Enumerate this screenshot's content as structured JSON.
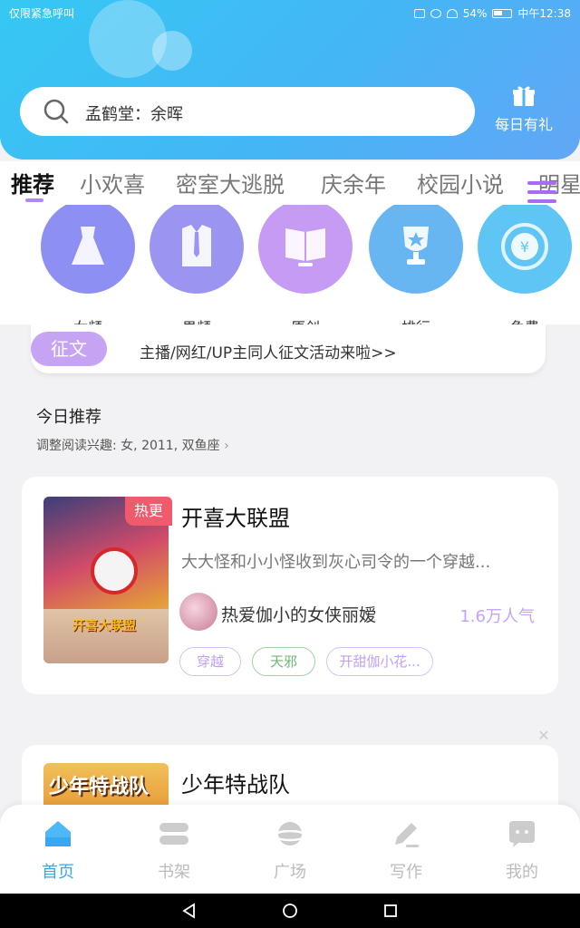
{
  "status_bar": {
    "left_text": "仅限紧急呼叫",
    "battery": "54%",
    "time": "中午12:38"
  },
  "search": {
    "placeholder": "孟鹤堂：余晖"
  },
  "gift": {
    "label": "每日有礼"
  },
  "tabs": [
    {
      "label": "推荐",
      "active": true
    },
    {
      "label": "小欢喜",
      "active": false
    },
    {
      "label": "密室大逃脱",
      "active": false
    },
    {
      "label": "庆余年",
      "active": false
    },
    {
      "label": "校园小说",
      "active": false
    },
    {
      "label": "明星",
      "active": false
    }
  ],
  "categories": [
    {
      "label": "女频",
      "icon": "dress-icon"
    },
    {
      "label": "男频",
      "icon": "shirt-icon"
    },
    {
      "label": "原创",
      "icon": "book-icon"
    },
    {
      "label": "排行",
      "icon": "trophy-icon"
    },
    {
      "label": "免费",
      "icon": "yuan-coin-icon"
    }
  ],
  "notice": {
    "badge": "征文",
    "text": "主播/网红/UP主同人征文活动来啦>>"
  },
  "recommend": {
    "title": "今日推荐",
    "subtitle": "调整阅读兴趣: 女, 2011, 双鱼座"
  },
  "books": [
    {
      "title": "开喜大联盟",
      "badge": "热更",
      "cover_text": "开喜大联盟",
      "description": "大大怪和小小怪收到灰心司令的一个穿越...",
      "author": "热爱伽小的女侠丽嫒",
      "popularity": "1.6万人气",
      "tags": [
        "穿越",
        "天邪",
        "开甜伽小花..."
      ]
    },
    {
      "title": "少年特战队",
      "cover_text": "少年特战队"
    }
  ],
  "bottom_nav": [
    {
      "label": "首页",
      "active": true
    },
    {
      "label": "书架",
      "active": false
    },
    {
      "label": "广场",
      "active": false
    },
    {
      "label": "写作",
      "active": false
    },
    {
      "label": "我的",
      "active": false
    }
  ],
  "colors": {
    "header_gradient_start": "#35c8f3",
    "accent_purple": "#c7a3f4",
    "accent_blue": "#36a8f0",
    "hot_badge": "#ef5a6c"
  }
}
